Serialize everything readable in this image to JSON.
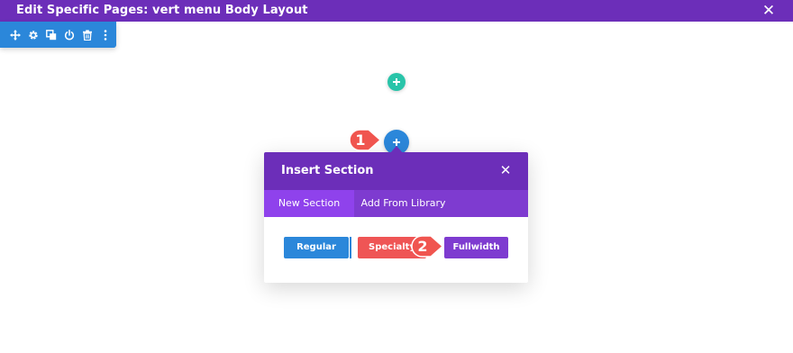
{
  "titlebar": {
    "title": "Edit Specific Pages: vert menu Body Layout",
    "close_icon": "close-icon"
  },
  "toolbar": {
    "icons": [
      "move-icon",
      "gear-icon",
      "duplicate-icon",
      "power-icon",
      "trash-icon",
      "more-vertical-icon"
    ]
  },
  "add_buttons": {
    "row_add_icon": "plus-icon",
    "section_add_icon": "plus-icon"
  },
  "modal": {
    "title": "Insert Section",
    "close_icon": "close-icon",
    "tabs": [
      {
        "label": "New Section",
        "active": true
      },
      {
        "label": "Add From Library",
        "active": false
      }
    ],
    "buttons": {
      "regular": "Regular",
      "specialty": "Specialty",
      "fullwidth": "Fullwidth"
    }
  },
  "callouts": {
    "step1": "1",
    "step2": "2"
  },
  "colors": {
    "purple_header": "#6c2eb9",
    "purple_tabs": "#7e3bd0",
    "purple_tab_active": "#8f42ec",
    "blue": "#2b87da",
    "teal": "#29c4a9",
    "red": "#ef5555",
    "callout": "#f0554f"
  }
}
